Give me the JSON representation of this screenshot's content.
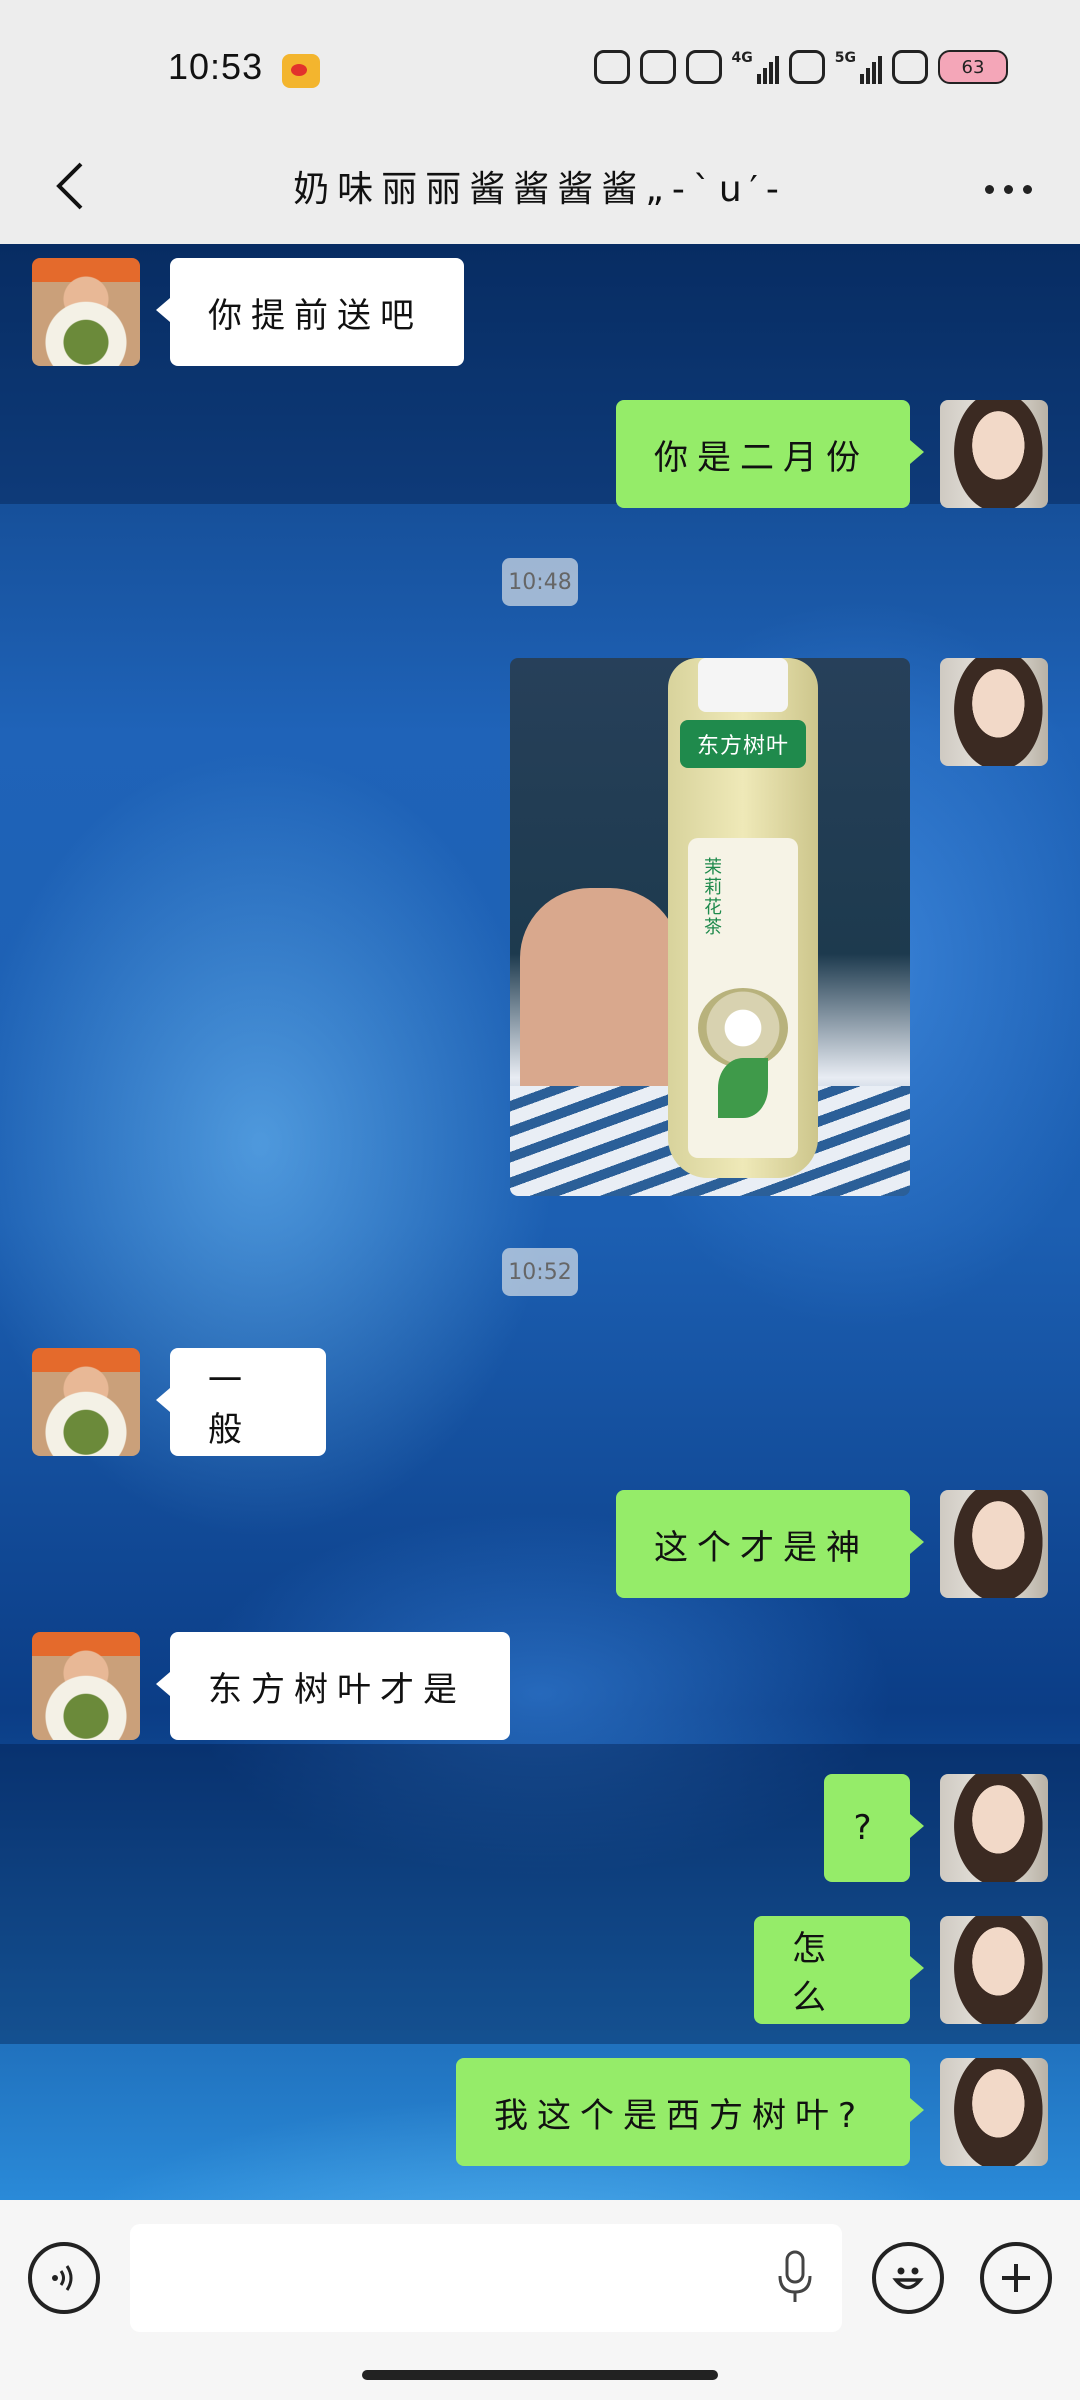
{
  "status_bar": {
    "time": "10:53",
    "app_icon": "weibo-icon",
    "network_1": "4G",
    "network_2": "5G",
    "battery": "63"
  },
  "header": {
    "title": "奶味丽丽酱酱酱酱„-ˋu′-",
    "back_icon": "chevron-left-icon",
    "more_icon": "more-dots-icon"
  },
  "messages": [
    {
      "side": "in",
      "text": "你提前送吧"
    },
    {
      "side": "out",
      "text": "你是二月份"
    },
    {
      "type": "timestamp",
      "text": "10:48"
    },
    {
      "side": "out",
      "type": "image",
      "image_text": "东方树叶",
      "label_text": "茉莉花茶"
    },
    {
      "type": "timestamp",
      "text": "10:52"
    },
    {
      "side": "in",
      "text": "一般"
    },
    {
      "side": "out",
      "text": "这个才是神"
    },
    {
      "side": "in",
      "text": "东方树叶才是"
    },
    {
      "side": "out",
      "text": "?"
    },
    {
      "side": "out",
      "text": "怎么"
    },
    {
      "side": "out",
      "text": "我这个是西方树叶?"
    }
  ],
  "input_bar": {
    "voice_icon": "voice-mode-icon",
    "input_value": "",
    "mic_icon": "microphone-icon",
    "emoji_icon": "emoji-icon",
    "plus_icon": "plus-icon"
  },
  "colors": {
    "bubble_out": "#95ec69",
    "bubble_in": "#ffffff",
    "bar_bg": "#ededed"
  }
}
